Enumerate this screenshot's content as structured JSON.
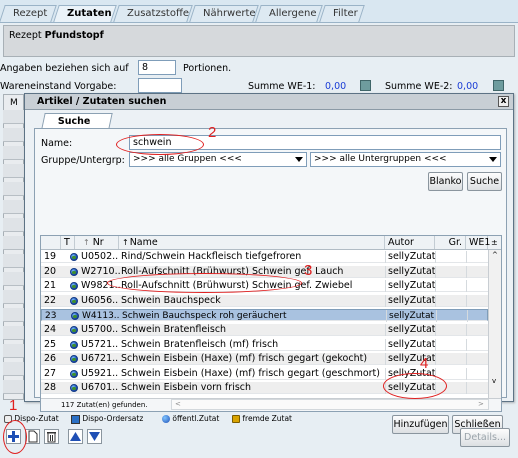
{
  "tabs": [
    "Rezept",
    "Zutaten",
    "Zusatzstoffe",
    "Nährwerte",
    "Allergene",
    "Filter"
  ],
  "active_tab": "Zutaten",
  "rezept": {
    "label": "Rezept",
    "name": "Pfundstopf"
  },
  "angaben": {
    "label": "Angaben beziehen sich auf",
    "value": "8",
    "suffix": "Portionen."
  },
  "wareneinstand": {
    "label": "Wareneinstand Vorgabe:",
    "summe1_label": "Summe WE-1:",
    "summe1_value": "0,00",
    "summe2_label": "Summe WE-2:",
    "summe2_value": "0,00"
  },
  "dialog": {
    "title": "Artikel / Zutaten suchen",
    "close": "x",
    "tab": "Suche",
    "name_label": "Name:",
    "name_value": "schwein",
    "gruppe_label": "Gruppe/Untergrp:",
    "gruppe_value": ">>> alle Gruppen <<<",
    "untergruppe_value": ">>> alle Untergruppen <<<",
    "blanko": "Blanko",
    "suche": "Suche",
    "columns": {
      "t": "T",
      "nr": "Nr",
      "name": "Name",
      "autor": "Autor",
      "gr": "Gr.",
      "we1": "WE1"
    },
    "rows": [
      {
        "num": "19",
        "nr": "U0502..",
        "name": "Rind/Schwein Hackfleisch tiefgefroren",
        "autor": "sellyZutat"
      },
      {
        "num": "20",
        "nr": "W2710..",
        "name": "Roll-Aufschnitt (Brühwurst) Schwein gef. Lauch",
        "autor": "sellyZutat"
      },
      {
        "num": "21",
        "nr": "W9821..",
        "name": "Roll-Aufschnitt (Brühwurst) Schwein gef. Zwiebel",
        "autor": "sellyZutat"
      },
      {
        "num": "22",
        "nr": "U6056..",
        "name": "Schwein Bauchspeck",
        "autor": "sellyZutat"
      },
      {
        "num": "23",
        "nr": "W4113..",
        "name": "Schwein Bauchspeck roh geräuchert",
        "autor": "sellyZutat"
      },
      {
        "num": "24",
        "nr": "U5700..",
        "name": "Schwein Bratenfleisch",
        "autor": "sellyZutat"
      },
      {
        "num": "25",
        "nr": "U5721..",
        "name": "Schwein Bratenfleisch (mf) frisch",
        "autor": "sellyZutat"
      },
      {
        "num": "26",
        "nr": "U6721..",
        "name": "Schwein Eisbein (Haxe) (mf) frisch gegart (gekocht)",
        "autor": "sellyZutat"
      },
      {
        "num": "27",
        "nr": "U5921..",
        "name": "Schwein Eisbein (Haxe) (mf) frisch gegart (geschmort)",
        "autor": "sellyZutat"
      },
      {
        "num": "28",
        "nr": "U6701..",
        "name": "Schwein Eisbein vorn frisch",
        "autor": "sellyZutat"
      }
    ],
    "selected_row": "23",
    "status": "117 Zutat(en) gefunden.",
    "hinzufuegen": "Hinzufügen",
    "schliessen": "Schließen"
  },
  "left_strip_label": "M",
  "legend": {
    "dispo": "Dispo-Zutat",
    "ordersatz": "Dispo-Ordersatz",
    "oeffentl": "öffentl.Zutat",
    "fremde": "fremde Zutat"
  },
  "details": "Details...",
  "annotations": [
    "1",
    "2",
    "3",
    "4"
  ],
  "colors": {
    "annotation": "#e02020",
    "selection": "#a9c2e0",
    "tab_bg": "#dde9f2"
  }
}
